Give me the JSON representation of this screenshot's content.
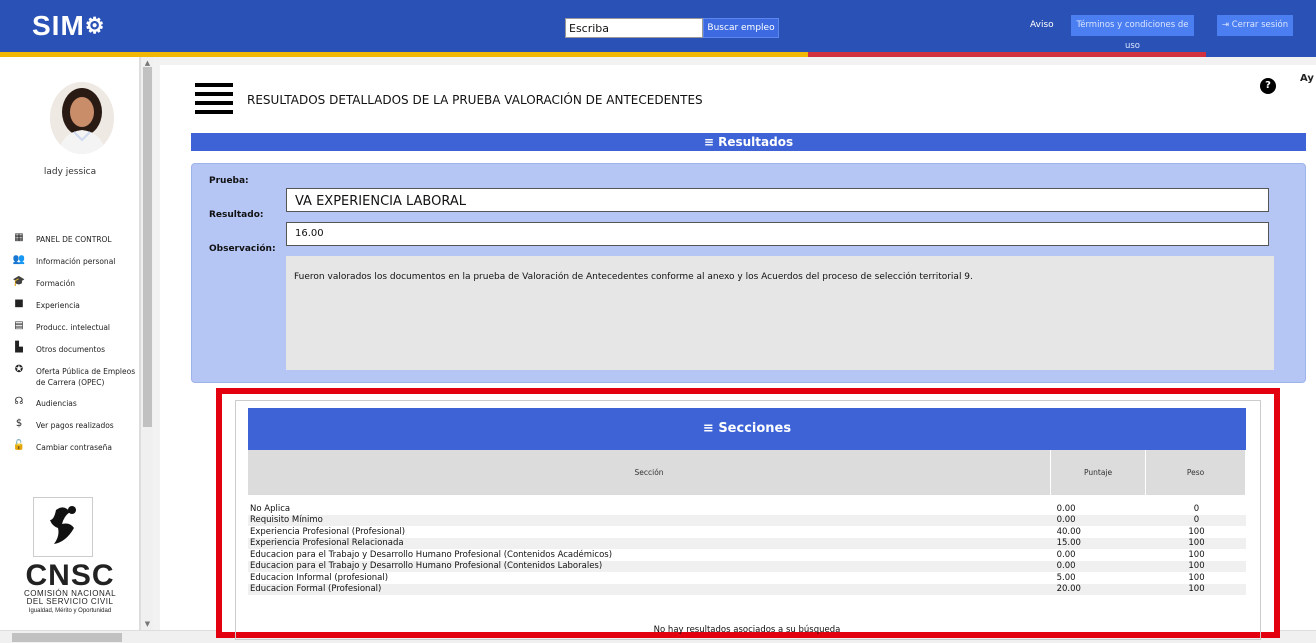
{
  "header": {
    "logo_text": "SIM",
    "search_value": "Escriba",
    "search_button": "Buscar empleo",
    "aviso": "Aviso",
    "terms_button": "Términos y condiciones de uso",
    "logout_button": "Cerrar sesión",
    "colors": {
      "bar": "#2a51b6",
      "yellow": "#f2b705",
      "red": "#d1303f"
    }
  },
  "sidebar": {
    "username": "lady jessica",
    "items": [
      {
        "label": "PANEL DE CONTROL",
        "icon": "dashboard-icon"
      },
      {
        "label": "Información personal",
        "icon": "people-icon"
      },
      {
        "label": "Formación",
        "icon": "graduation-icon"
      },
      {
        "label": "Experiencia",
        "icon": "briefcase-icon"
      },
      {
        "label": "Producc. intelectual",
        "icon": "book-icon"
      },
      {
        "label": "Otros documentos",
        "icon": "document-icon"
      },
      {
        "label": "Oferta Pública de Empleos de Carrera (OPEC)",
        "icon": "globe-icon"
      },
      {
        "label": "Audiencias",
        "icon": "audience-icon"
      },
      {
        "label": "Ver pagos realizados",
        "icon": "dollar-icon"
      },
      {
        "label": "Cambiar contraseña",
        "icon": "lock-icon"
      }
    ],
    "org": {
      "name": "CNSC",
      "subtitle1": "COMISIÓN NACIONAL",
      "subtitle2": "DEL SERVICIO CIVIL",
      "tagline": "Igualdad, Mérito y Oportunidad"
    }
  },
  "main": {
    "title": "RESULTADOS DETALLADOS DE LA PRUEBA VALORACIÓN DE ANTECEDENTES",
    "help_short": "Ay",
    "results_header": "Resultados",
    "labels": {
      "prueba": "Prueba:",
      "resultado": "Resultado:",
      "observacion": "Observación:"
    },
    "prueba": "VA EXPERIENCIA LABORAL",
    "resultado": "16.00",
    "observacion": "Fueron valorados los documentos en la prueba de Valoración de Antecedentes conforme al anexo y los Acuerdos del proceso de selección territorial 9.",
    "sections": {
      "header": "Secciones",
      "columns": [
        "Sección",
        "Puntaje",
        "Peso"
      ],
      "rows": [
        [
          "No Aplica",
          "0.00",
          "0"
        ],
        [
          "Requisito Mínimo",
          "0.00",
          "0"
        ],
        [
          "Experiencia Profesional (Profesional)",
          "40.00",
          "100"
        ],
        [
          "Experiencia Profesional Relacionada",
          "15.00",
          "100"
        ],
        [
          "Educacion para el Trabajo y Desarrollo Humano Profesional (Contenidos Académicos)",
          "0.00",
          "100"
        ],
        [
          "Educacion para el Trabajo y Desarrollo Humano Profesional (Contenidos Laborales)",
          "0.00",
          "100"
        ],
        [
          "Educacion Informal (profesional)",
          "5.00",
          "100"
        ],
        [
          "Educacion Formal (Profesional)",
          "20.00",
          "100"
        ]
      ],
      "empty_message": "No hay resultados asociados a su búsqueda"
    }
  }
}
